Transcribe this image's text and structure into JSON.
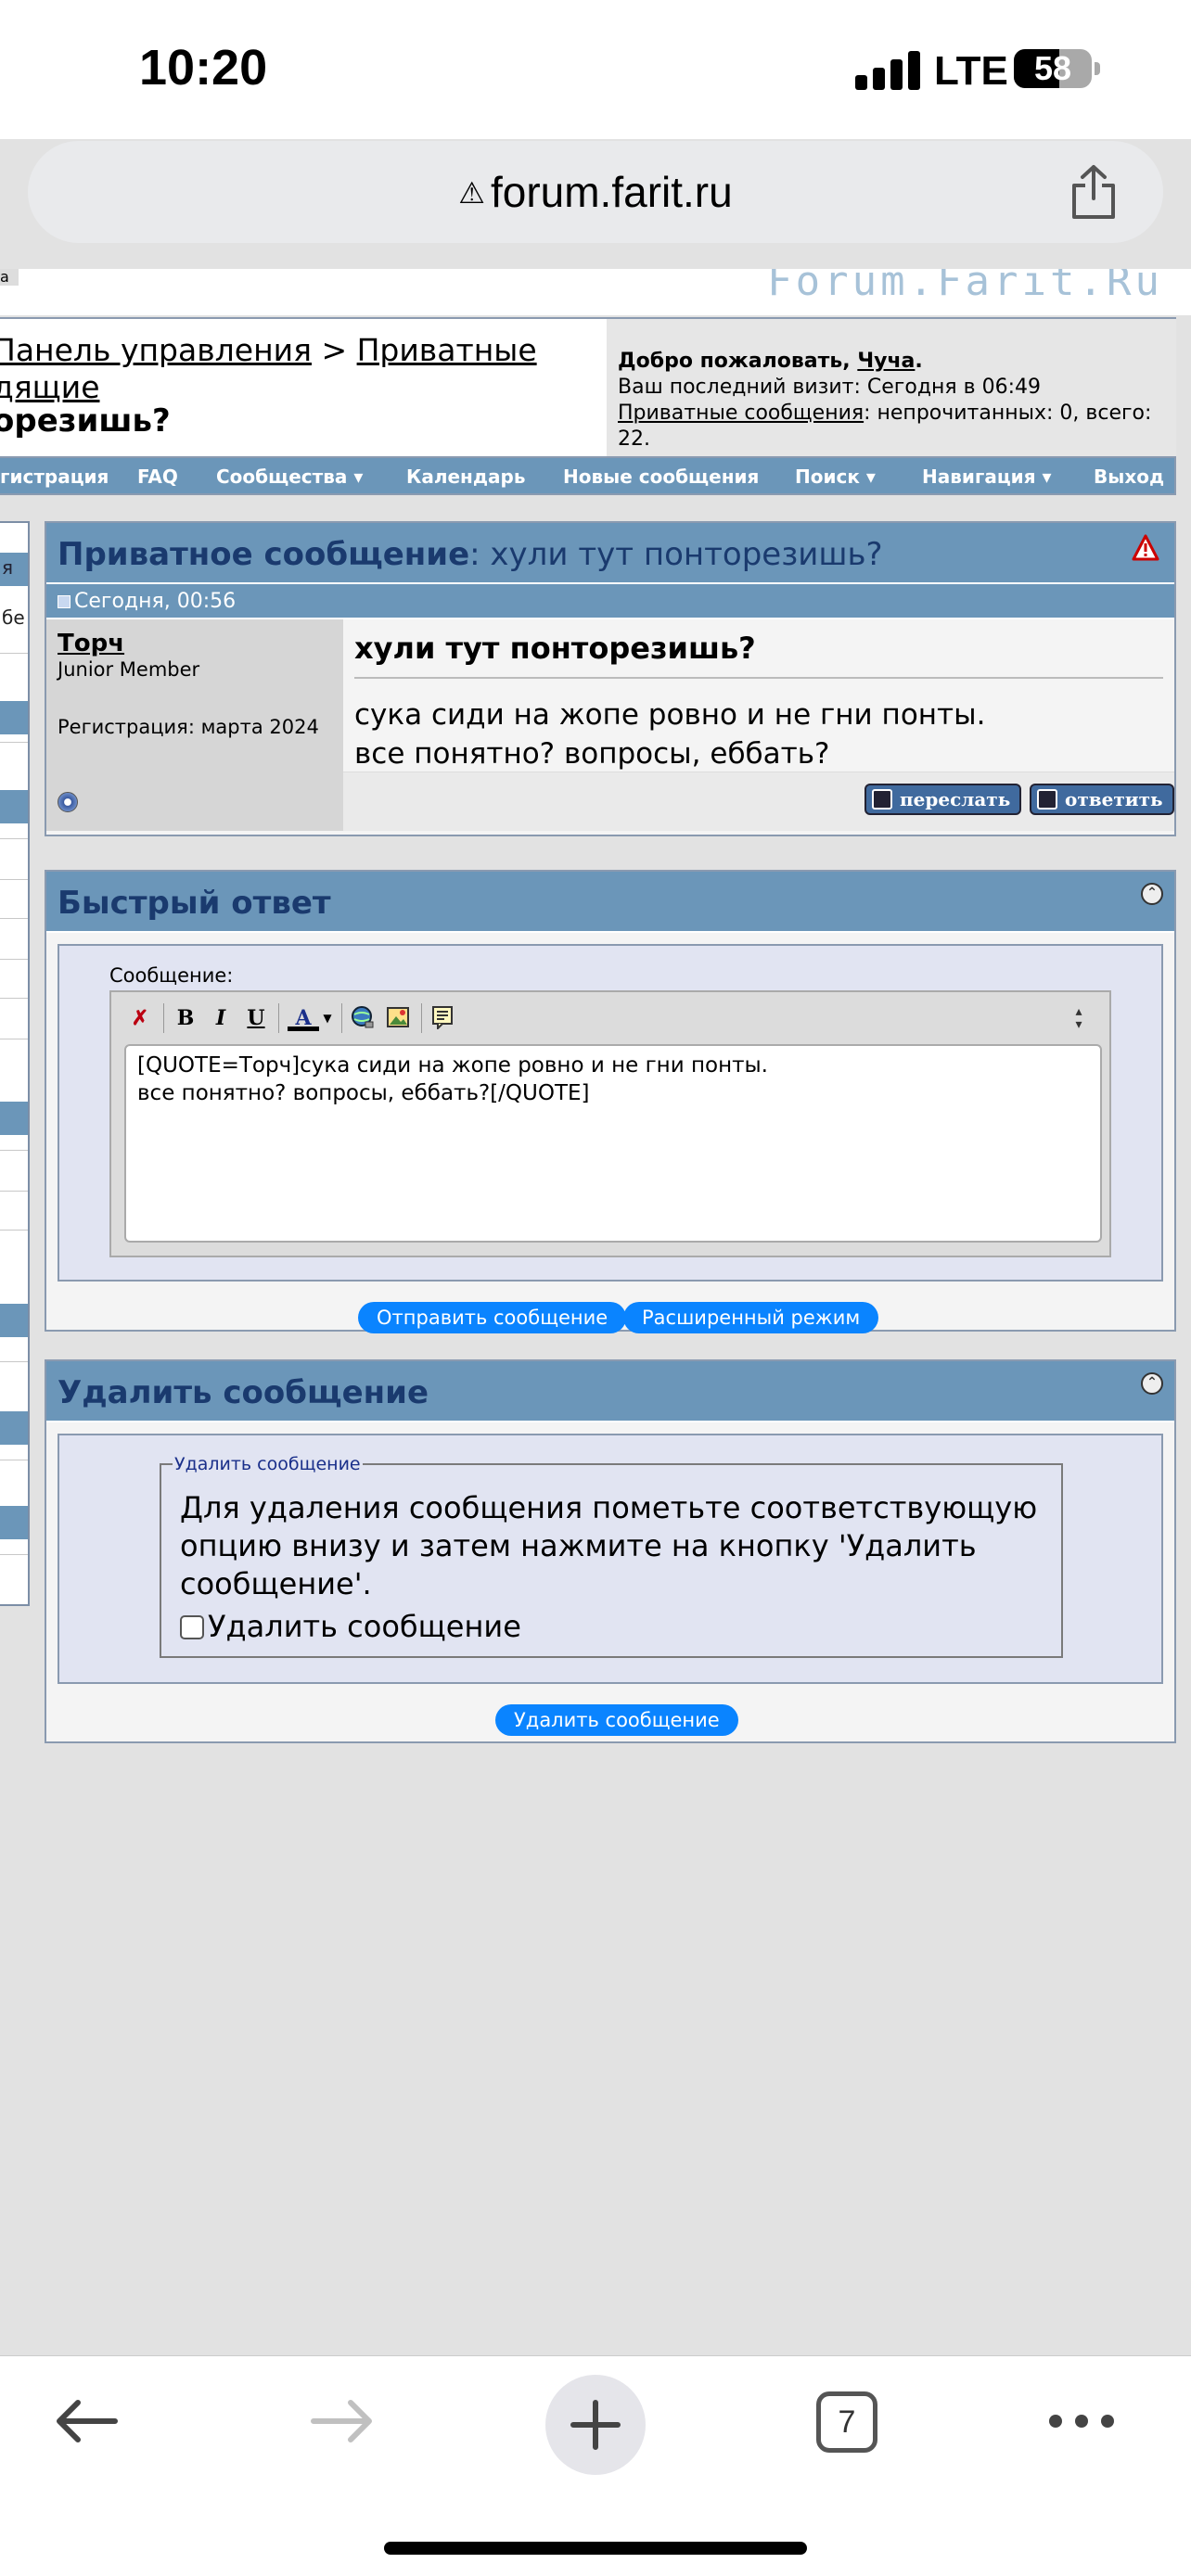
{
  "status": {
    "time": "10:20",
    "network": "LTE",
    "battery": "58",
    "battery_level": 0.58
  },
  "browser": {
    "url": "forum.farit.ru",
    "tabs_count": "7"
  },
  "header": {
    "logo_cut": "а",
    "logo": "Forum.Farit.Ru",
    "crumb_line1_a": "Панель управления",
    "crumb_sep": " > ",
    "crumb_line1_b": "Приватные",
    "crumb_line2": "дящие",
    "title_cut": "орезишь?",
    "welcome_prefix": "Добро пожаловать, ",
    "welcome_user": "Чуча",
    "welcome_suffix": ".",
    "last_visit": "Ваш последний визит: Сегодня в 06:49",
    "pm_link": "Приватные сообщения",
    "pm_stats": ": непрочитанных: 0, всего: 22."
  },
  "nav": {
    "items": [
      {
        "label": "гистрация"
      },
      {
        "label": "FAQ"
      },
      {
        "label": "Сообщества ▾"
      },
      {
        "label": "Календарь"
      },
      {
        "label": "Новые сообщения"
      },
      {
        "label": "Поиск ▾"
      },
      {
        "label": "Навигация ▾"
      },
      {
        "label": "Выход"
      }
    ]
  },
  "sidebar_cut": {
    "t1": "я",
    "t2": "бе"
  },
  "pm": {
    "heading_bold": "Приватное сообщение",
    "heading_rest": ": хули тут понторезишь?",
    "date": "Сегодня, 00:56",
    "author": "Торч",
    "rank": "Junior Member",
    "registration": "Регистрация: марта 2024",
    "title": "хули тут понторезишь?",
    "text_line1": "сука сиди на жопе ровно и не гни понты.",
    "text_line2": "все понятно? вопросы, еббать?",
    "forward_label": "переслать",
    "reply_label": "ответить"
  },
  "quick_reply": {
    "heading": "Быстрый ответ",
    "message_label": "Сообщение:",
    "toolbar": {
      "bold": "B",
      "italic": "I",
      "underline": "U",
      "color": "A"
    },
    "editor_value": "[QUOTE=Торч]сука сиди на жопе ровно и не гни понты.\nвсе понятно? вопросы, еббать?[/QUOTE]",
    "send_label": "Отправить сообщение",
    "advanced_label": "Расширенный режим"
  },
  "delete": {
    "heading": "Удалить сообщение",
    "legend": "Удалить сообщение",
    "instructions": "Для удаления сообщения пометьте соответствующую опцию внизу и затем нажмите на кнопку 'Удалить сообщение'.",
    "checkbox_label": "Удалить сообщение",
    "button_label": "Удалить сообщение"
  },
  "colors": {
    "accent": "#6b96b9",
    "heading": "#1a3a6e",
    "button": "#0a84ff"
  }
}
